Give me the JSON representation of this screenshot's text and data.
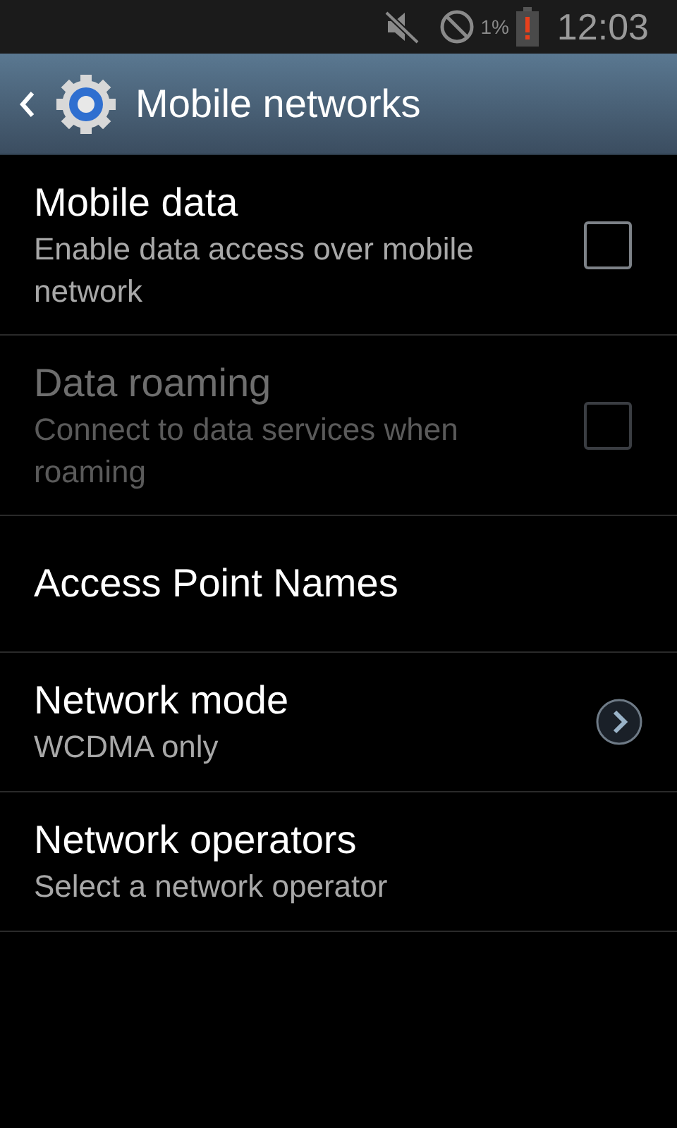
{
  "status_bar": {
    "battery_percent": "1%",
    "time": "12:03"
  },
  "action_bar": {
    "title": "Mobile networks"
  },
  "items": [
    {
      "kind": "checkbox",
      "title": "Mobile data",
      "summary": "Enable data access over mobile network",
      "checked": false,
      "disabled": false
    },
    {
      "kind": "checkbox",
      "title": "Data roaming",
      "summary": "Connect to data services when roaming",
      "checked": false,
      "disabled": true
    },
    {
      "kind": "plain",
      "title": "Access Point Names",
      "disabled": false
    },
    {
      "kind": "chevron",
      "title": "Network mode",
      "summary": "WCDMA only",
      "disabled": false
    },
    {
      "kind": "plain",
      "title": "Network operators",
      "summary": "Select a network operator",
      "disabled": false
    }
  ]
}
